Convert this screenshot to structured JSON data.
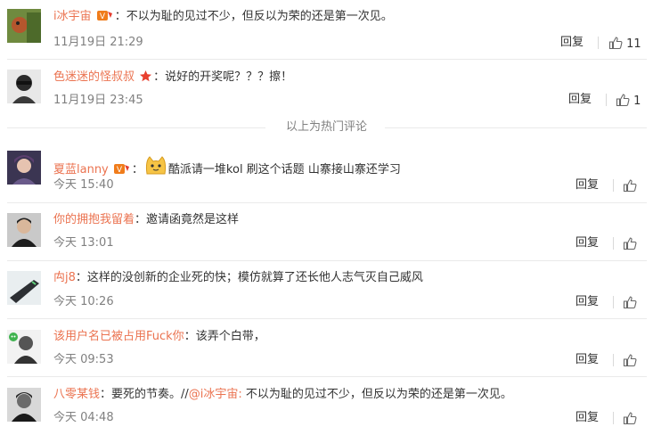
{
  "hot_label": "以上为热门评论",
  "reply_label": "回复",
  "comments": [
    {
      "user": "i冰宇宙",
      "sep": "：",
      "text": "不以为耻的见过不少，但反以为荣的还是第一次见。",
      "time": "11月19日 21:29",
      "likes": "11"
    },
    {
      "user": "色迷迷的怪叔叔",
      "sep": "：",
      "text": "说好的开奖呢？？？擦！",
      "time": "11月19日 23:45",
      "likes": "1"
    },
    {
      "user": "夏蓝lanny",
      "sep": "：",
      "text": "酷派请一堆kol 刷这个话题 山寨接山寨还学习",
      "time": "今天 15:40",
      "likes": ""
    },
    {
      "user": "你的拥抱我留着",
      "sep": "：",
      "text": "邀请函竟然是这样",
      "time": "今天 13:01",
      "likes": ""
    },
    {
      "user": "禸j8",
      "sep": "：",
      "text": "这样的没创新的企业死的快；模仿就算了还长他人志气灭自己威风",
      "time": "今天 10:26",
      "likes": ""
    },
    {
      "user": "该用户名已被占用Fuck你",
      "sep": "：",
      "text": "该弄个白带，",
      "time": "今天 09:53",
      "likes": ""
    },
    {
      "user": "八零某钱",
      "sep": "：",
      "text": "要死的节奏。//",
      "mention": "@i冰宇宙:",
      "text2": " 不以为耻的见过不少，但反以为荣的还是第一次见。",
      "time": "今天 04:48",
      "likes": ""
    }
  ]
}
